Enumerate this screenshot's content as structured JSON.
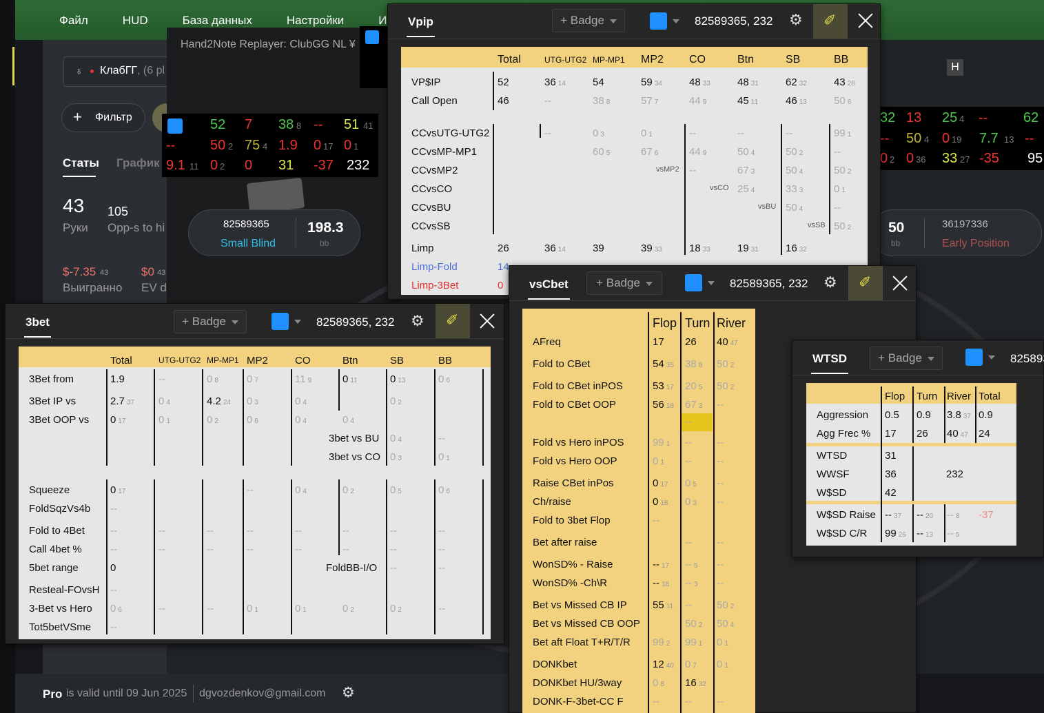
{
  "menu": [
    "Файл",
    "HUD",
    "База данных",
    "Настройки",
    "И"
  ],
  "replayer_title": "Hand2Note Replayer: ClubGG NL ¥",
  "club": {
    "name": "КлабГГ",
    "suffix": ", (6 pl"
  },
  "filter_label": "Фильтр",
  "tabs": [
    "Статы",
    "График"
  ],
  "stats": {
    "hands": "43",
    "hands_label": "Руки",
    "opps": "105",
    "opps_label": "Opp-s to hi",
    "won": "$-7.35",
    "won_sub": "43",
    "won_label": "Выигранно",
    "ev": "$0",
    "ev_sub": "43",
    "ev_label": "EV di"
  },
  "seat_left": {
    "id": "82589365",
    "pos": "Small Blind",
    "stack": "198.3",
    "unit": "bb"
  },
  "seat_right": {
    "stack": "50",
    "unit": "bb",
    "id": "36197336",
    "pos": "Early Position"
  },
  "hud_left": {
    "r1": [
      "52",
      "7",
      "38",
      "8",
      "--",
      "51",
      "41"
    ],
    "r2": [
      "--",
      "50",
      "2",
      "75",
      "4",
      "1.9",
      "0",
      "17",
      "0",
      "1"
    ],
    "r3": [
      "9.1",
      "11",
      "0",
      "2",
      "0",
      "31",
      "-37",
      "232"
    ]
  },
  "hud_right": {
    "r1": [
      "32",
      "13",
      "25",
      "4",
      "--",
      "62"
    ],
    "r2": [
      "--",
      "50",
      "4",
      "0",
      "19",
      "7.7",
      "13",
      "--"
    ],
    "r3": [
      "0",
      "2",
      "0",
      "36",
      "33",
      "27",
      "-35",
      "95"
    ]
  },
  "footer": {
    "pro": "Pro",
    "valid": "is valid until 09 Jun 2025",
    "email": "dgvozdenkov@gmail.com"
  },
  "badge_label": "+ Badge",
  "player_id": "82589365, 232",
  "vpip": {
    "title": "Vpip",
    "cols": [
      "Total",
      "UTG-UTG2",
      "MP-MP1",
      "MP2",
      "CO",
      "Btn",
      "SB",
      "BB"
    ],
    "rows": [
      "VP$IP",
      "Call Open",
      "CCvsUTG-UTG2",
      "CCvsMP-MP1",
      "CCvsMP2",
      "CCvsCO",
      "CCvsBU",
      "CCvsSB",
      "Limp",
      "Limp-Fold",
      "Limp-3Bet"
    ],
    "vs": [
      "vsMP2",
      "vsCO",
      "vsBU",
      "vsSB"
    ]
  },
  "threebet": {
    "title": "3bet",
    "cols": [
      "Total",
      "UTG-UTG2",
      "MP-MP1",
      "MP2",
      "CO",
      "Btn",
      "SB",
      "BB"
    ],
    "rows": [
      "3Bet from",
      "3Bet IP vs",
      "3Bet OOP vs",
      "Squeeze",
      "FoldSqzVs4b",
      "Fold to 4Bet",
      "Call 4bet %",
      "5bet range",
      "Resteal-FOvsH",
      "3-Bet vs Hero",
      "Tot5betVSme"
    ],
    "extra": [
      "3bet vs BU",
      "3bet vs CO",
      "FoldBB-I/O"
    ]
  },
  "vscbet": {
    "title": "vsCbet",
    "cols": [
      "Flop",
      "Turn",
      "River"
    ],
    "rows": [
      "AFreq",
      "Fold to CBet",
      "Fold to CBet inPOS",
      "Fold to CBet OOP",
      "Fold vs Hero inPOS",
      "Fold vs Hero OOP",
      "Raise CBet inPos",
      "Ch/raise",
      "Fold to 3bet Flop",
      "Bet after raise",
      "WonSD% - Raise",
      "WonSD% -Ch\\R",
      "Bet vs Missed CB IP",
      "Bet vs Missed CB OOP",
      "Bet aft Float T+R/T/R",
      "DONKbet",
      "DONKbet HU/3way",
      "DONK-F-3bet-CC F"
    ]
  },
  "wtsd": {
    "title": "WTSD",
    "id_partial": "825893",
    "cols": [
      "Flop",
      "Turn",
      "River",
      "Total"
    ],
    "rows": [
      "Aggression",
      "Agg Frec %",
      "WTSD",
      "WWSF",
      "W$SD",
      "W$SD Raise",
      "W$SD C/R"
    ]
  }
}
